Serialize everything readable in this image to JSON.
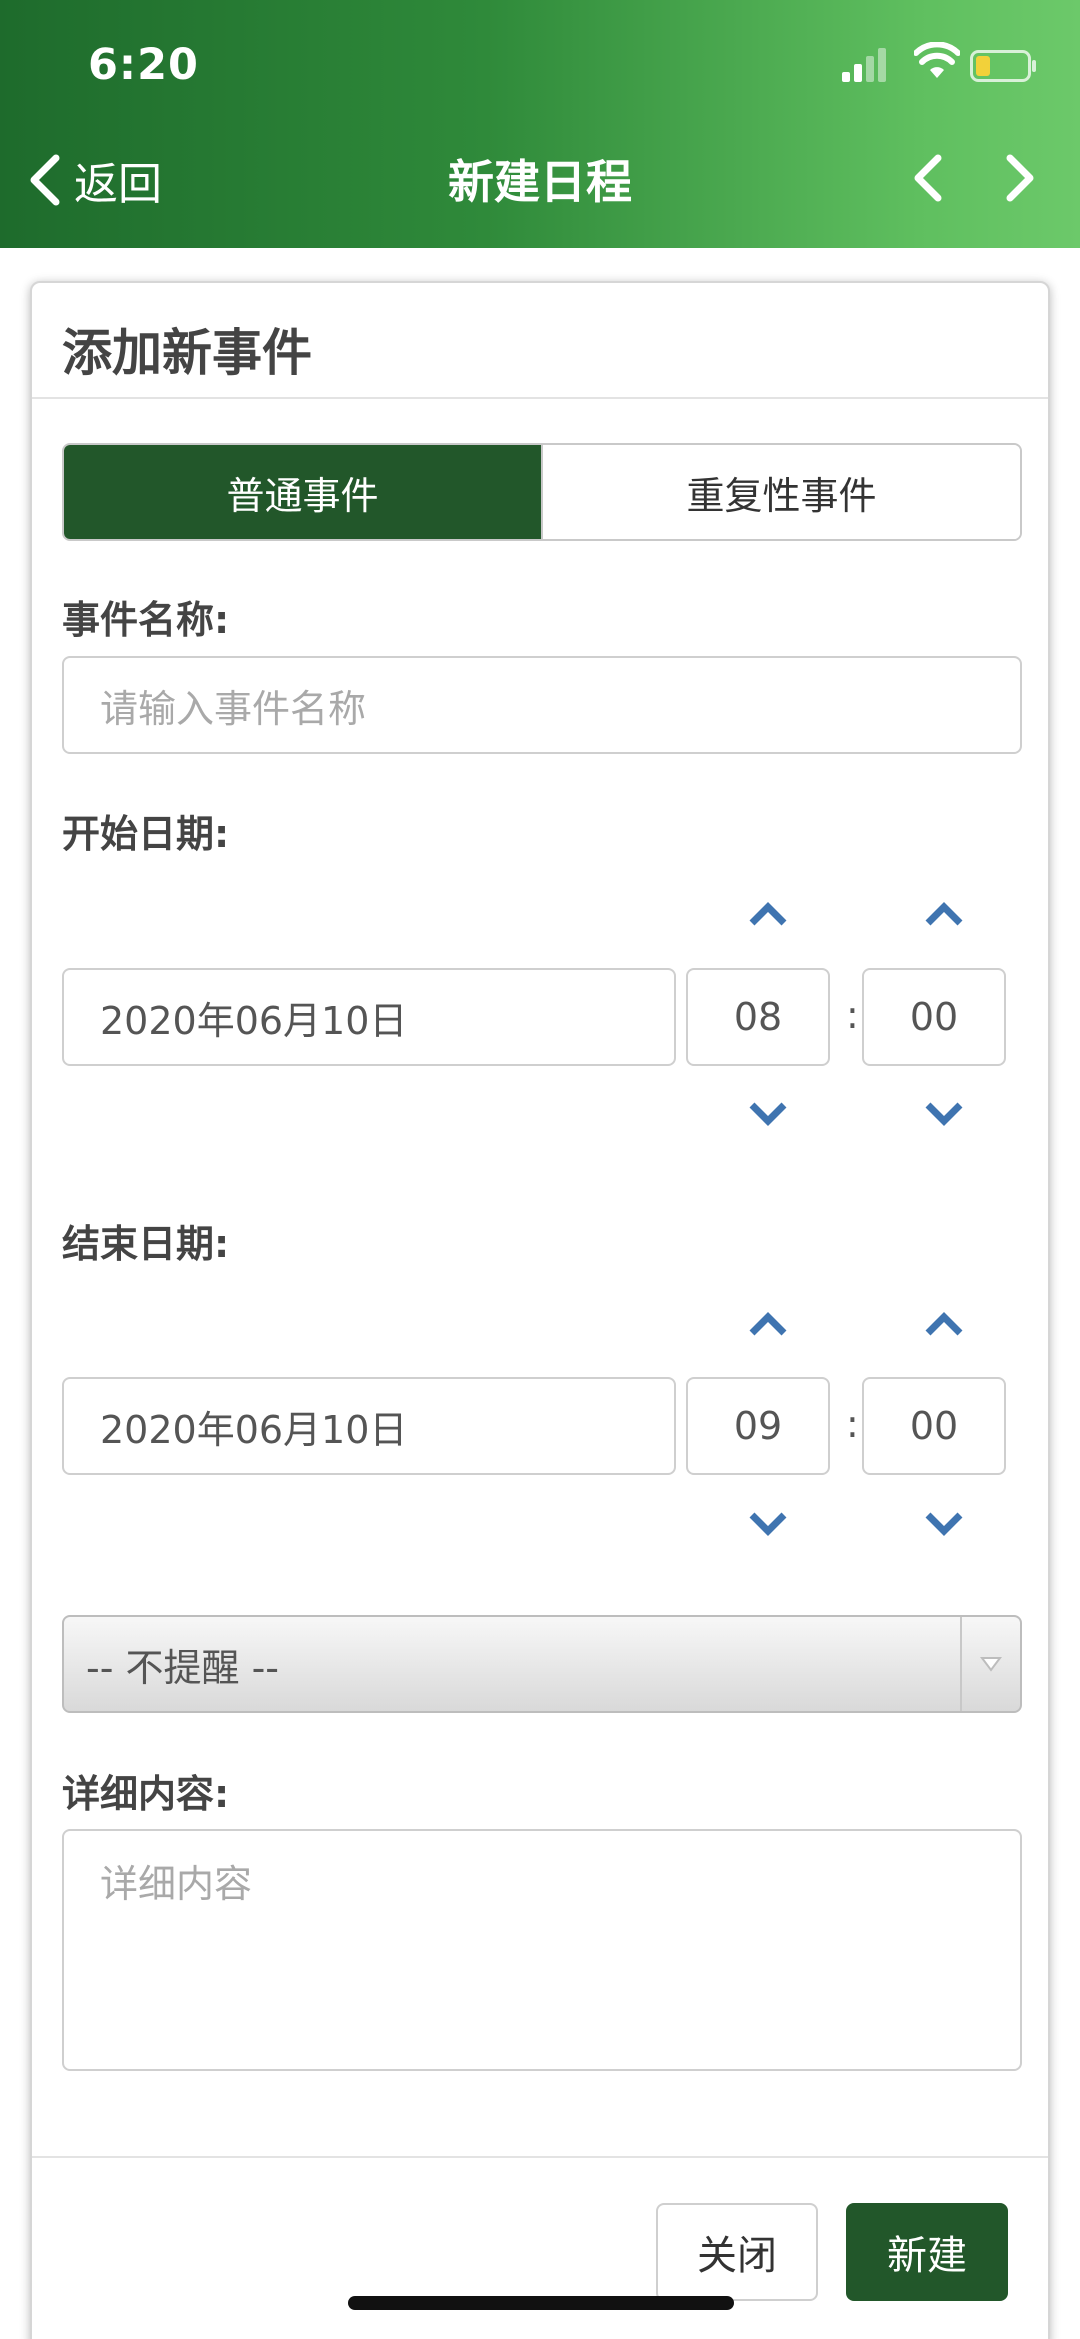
{
  "status_bar": {
    "time": "6:20"
  },
  "nav": {
    "back_label": "返回",
    "title": "新建日程"
  },
  "card": {
    "title": "添加新事件",
    "tabs": [
      {
        "label": "普通事件",
        "active": true
      },
      {
        "label": "重复性事件",
        "active": false
      }
    ],
    "event_name": {
      "label": "事件名称:",
      "placeholder": "请输入事件名称",
      "value": ""
    },
    "start": {
      "label": "开始日期:",
      "date": "2020年06月10日",
      "hour": "08",
      "minute": "00"
    },
    "end": {
      "label": "结束日期:",
      "date": "2020年06月10日",
      "hour": "09",
      "minute": "00"
    },
    "time_separator": ":",
    "reminder": {
      "selected": "-- 不提醒 --"
    },
    "details": {
      "label": "详细内容:",
      "placeholder": "详细内容"
    },
    "buttons": {
      "close": "关闭",
      "create": "新建"
    }
  },
  "colors": {
    "header_gradient_start": "#1e6b2c",
    "header_gradient_end": "#6cc96a",
    "primary_green": "#22572a",
    "chevron_blue": "#3f74b0"
  }
}
